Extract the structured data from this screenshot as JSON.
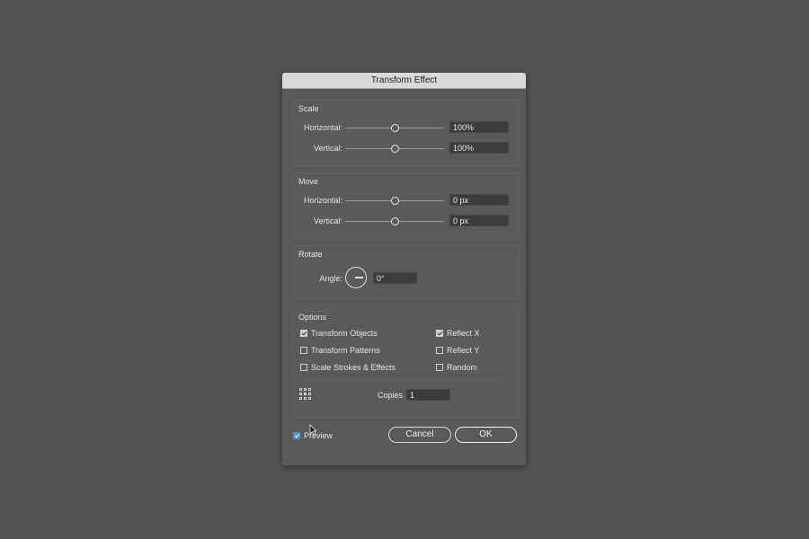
{
  "dialog": {
    "title": "Transform Effect"
  },
  "scale": {
    "label": "Scale",
    "horizontal_label": "Horizontal:",
    "horizontal_value": "100%",
    "vertical_label": "Vertical:",
    "vertical_value": "100%"
  },
  "move": {
    "label": "Move",
    "horizontal_label": "Horizontal:",
    "horizontal_value": "0 px",
    "vertical_label": "Vertical:",
    "vertical_value": "0 px"
  },
  "rotate": {
    "label": "Rotate",
    "angle_label": "Angle:",
    "angle_value": "0°"
  },
  "options": {
    "label": "Options",
    "transform_objects": {
      "label": "Transform Objects",
      "checked": true
    },
    "transform_patterns": {
      "label": "Transform Patterns",
      "checked": false
    },
    "scale_strokes": {
      "label": "Scale Strokes & Effects",
      "checked": false
    },
    "reflect_x": {
      "label": "Reflect X",
      "checked": true
    },
    "reflect_y": {
      "label": "Reflect Y",
      "checked": false
    },
    "random": {
      "label": "Random",
      "checked": false
    },
    "copies_label": "Copies",
    "copies_value": "1"
  },
  "footer": {
    "preview_label": "Preview",
    "preview_checked": true,
    "cancel_label": "Cancel",
    "ok_label": "OK"
  },
  "colors": {
    "background": "#535353",
    "dialog": "#5a5a5a",
    "titlebar": "#d9d9d9",
    "accent": "#4a90d9"
  }
}
